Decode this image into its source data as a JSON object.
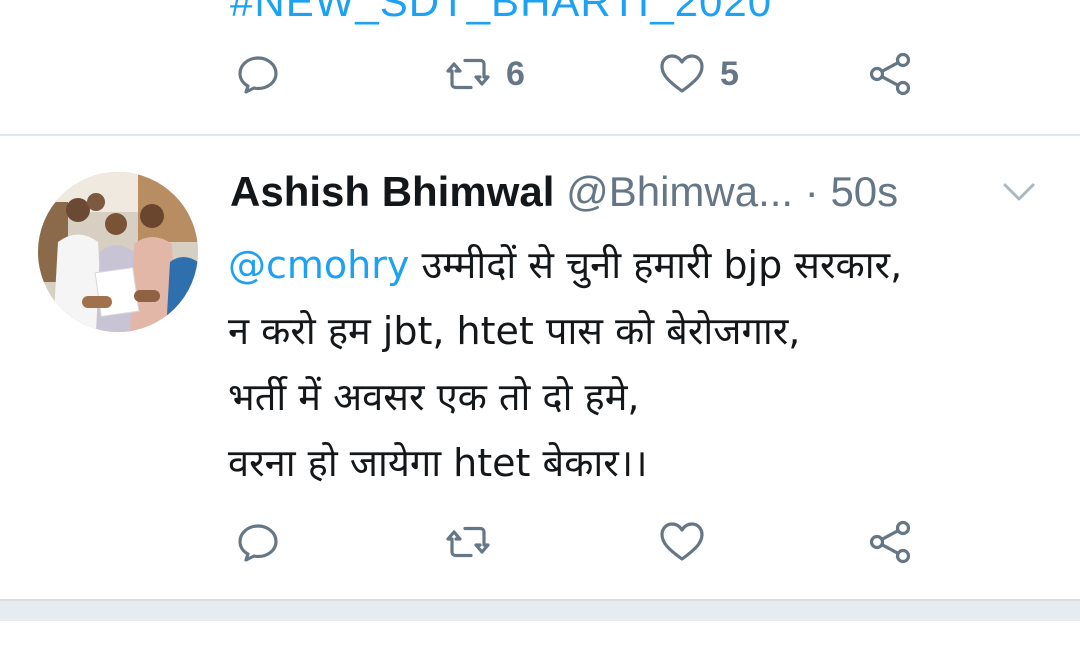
{
  "previous_tweet": {
    "hashtag_partial": "#NEW_SDT_BHARTI_2020",
    "actions": {
      "reply": {
        "icon": "reply-icon",
        "count": ""
      },
      "retweet": {
        "icon": "retweet-icon",
        "count": "6"
      },
      "like": {
        "icon": "heart-icon",
        "count": "5"
      },
      "share": {
        "icon": "share-icon",
        "count": ""
      }
    }
  },
  "tweet": {
    "display_name": "Ashish Bhimwal",
    "handle": "@Bhimwa...",
    "separator": "·",
    "time": "50s",
    "mention": "@cmohry",
    "line1_rest": " उम्मीदों से चुनी हमारी bjp सरकार,",
    "line2": "न करो हम jbt, htet पास को बेरोजगार,",
    "line3": "भर्ती में अवसर एक तो दो हमे,",
    "line4": "वरना हो जायेगा htet बेकार।।",
    "actions": {
      "reply": {
        "icon": "reply-icon",
        "count": ""
      },
      "retweet": {
        "icon": "retweet-icon",
        "count": ""
      },
      "like": {
        "icon": "heart-icon",
        "count": ""
      },
      "share": {
        "icon": "share-icon",
        "count": ""
      }
    }
  },
  "colors": {
    "accent": "#1da1f2",
    "muted": "#657786",
    "text": "#14171a",
    "divider": "#e1e8ed"
  }
}
